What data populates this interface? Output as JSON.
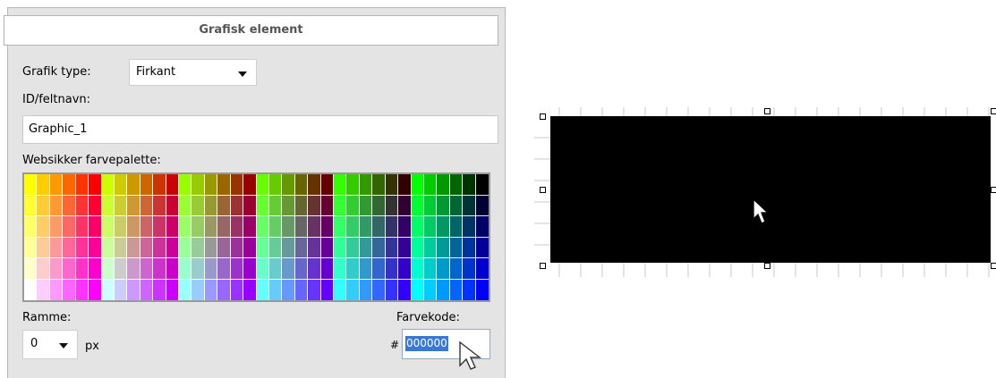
{
  "panel": {
    "title": "Grafisk element",
    "graphic_type_label": "Grafik type:",
    "graphic_type_value": "Firkant",
    "id_label": "ID/feltnavn:",
    "id_value": "Graphic_1",
    "palette_label": "Websikker farvepalette:",
    "border_label": "Ramme:",
    "border_value": "0",
    "border_unit": "px",
    "color_code_label": "Farvekode:",
    "hash": "#",
    "color_code_value": "000000"
  },
  "canvas": {
    "shape_fill": "#000000",
    "shape_type": "rectangle"
  },
  "colors": {
    "panel_bg": "#e4e4e4",
    "selection": "#3a78d8"
  }
}
